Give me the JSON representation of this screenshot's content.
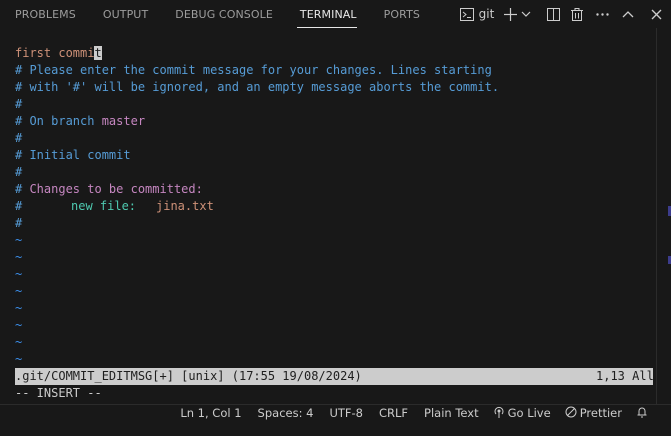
{
  "panel": {
    "tabs": [
      {
        "label": "PROBLEMS"
      },
      {
        "label": "OUTPUT"
      },
      {
        "label": "DEBUG CONSOLE"
      },
      {
        "label": "TERMINAL"
      },
      {
        "label": "PORTS"
      }
    ],
    "active_tab": "TERMINAL",
    "terminal_name": "git"
  },
  "editor": {
    "first_line": "first commi",
    "cursor_char": "t",
    "comment_lines": [
      "# Please enter the commit message for your changes. Lines starting",
      "# with '#' will be ignored, and an empty message aborts the commit.",
      "#"
    ],
    "branch_prefix": "# On branch ",
    "branch_name": "master",
    "hash_1": "#",
    "hash_2": "#",
    "initial_commit": "# Initial commit",
    "hash_3": "#",
    "changes_hash": "# ",
    "changes_label": "Changes to be committed:",
    "newfile_hash": "#",
    "newfile_label": "new file:",
    "newfile_name": "jina.txt",
    "hash_4": "#",
    "tildes": [
      "~",
      "~",
      "~",
      "~",
      "~",
      "~",
      "~",
      "~",
      "~"
    ],
    "status_left": ".git/COMMIT_EDITMSG[+] [unix] (17:55 19/08/2024)",
    "status_right": "1,13 All",
    "mode": "-- INSERT --"
  },
  "statusbar": {
    "position": "Ln 1, Col 1",
    "spaces": "Spaces: 4",
    "encoding": "UTF-8",
    "eol": "CRLF",
    "language": "Plain Text",
    "golive": "Go Live",
    "prettier": "Prettier"
  },
  "colors": {
    "accent_tab_underline": "#e7e7e7",
    "background": "#181818"
  }
}
